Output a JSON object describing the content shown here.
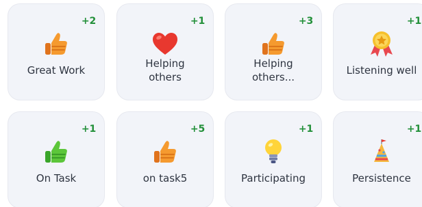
{
  "cards": [
    {
      "label": "Great Work",
      "count": "+2",
      "icon": "thumbs-up-orange"
    },
    {
      "label": "Helping\nothers",
      "count": "+1",
      "icon": "red-heart"
    },
    {
      "label": "Helping\nothers...",
      "count": "+3",
      "icon": "thumbs-up-orange"
    },
    {
      "label": "Listening well",
      "count": "+1",
      "icon": "medal"
    },
    {
      "label": "On Task",
      "count": "+1",
      "icon": "thumbs-up-green"
    },
    {
      "label": "on task5",
      "count": "+5",
      "icon": "thumbs-up-orange"
    },
    {
      "label": "Participating",
      "count": "+1",
      "icon": "light-bulb"
    },
    {
      "label": "Persistence",
      "count": "+1",
      "icon": "party-hat"
    }
  ],
  "colors": {
    "card_bg": "#f2f4f9",
    "count_green": "#23903a",
    "label_text": "#2e3440"
  }
}
